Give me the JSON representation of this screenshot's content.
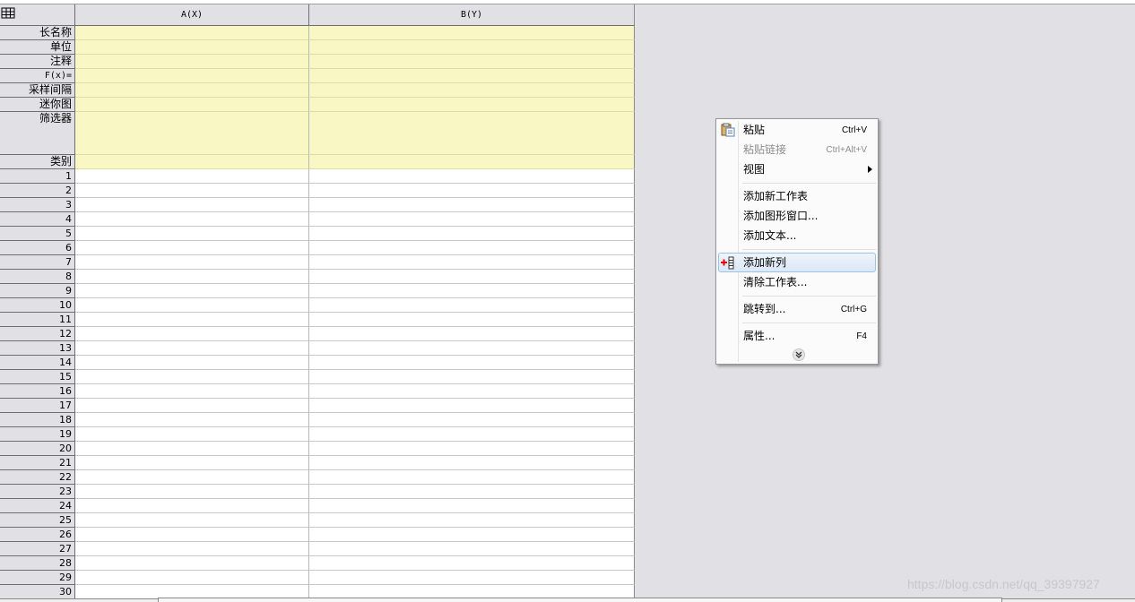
{
  "sheet": {
    "corner": "",
    "columns": [
      "A(X)",
      "B(Y)"
    ],
    "meta_rows": [
      "长名称",
      "单位",
      "注释",
      "F(x)=",
      "采样间隔",
      "迷你图",
      "筛选器",
      "类别"
    ],
    "data_rows": [
      "1",
      "2",
      "3",
      "4",
      "5",
      "6",
      "7",
      "8",
      "9",
      "10",
      "11",
      "12",
      "13",
      "14",
      "15",
      "16",
      "17",
      "18",
      "19",
      "20",
      "21",
      "22",
      "23",
      "24",
      "25",
      "26",
      "27",
      "28",
      "29",
      "30"
    ]
  },
  "context_menu": {
    "items": [
      {
        "label": "粘贴",
        "shortcut": "Ctrl+V",
        "icon": "paste-icon"
      },
      {
        "label": "粘贴链接",
        "shortcut": "Ctrl+Alt+V",
        "disabled": true
      },
      {
        "label": "视图",
        "submenu": true
      },
      {
        "label": "添加新工作表"
      },
      {
        "label": "添加图形窗口..."
      },
      {
        "label": "添加文本..."
      },
      {
        "label": "添加新列",
        "icon": "add-column-icon",
        "highlighted": true
      },
      {
        "label": "清除工作表..."
      },
      {
        "label": "跳转到...",
        "shortcut": "Ctrl+G"
      },
      {
        "label": "属性...",
        "shortcut": "F4"
      }
    ],
    "expand_icon": "double-chevron-down-icon"
  },
  "watermark": "https://blog.csdn.net/qq_39397927",
  "colors": {
    "meta_background": "#f9f8c4",
    "header_background": "#e1e0e4",
    "highlight": "#dbe8f7",
    "add_icon_red": "#e60012"
  }
}
